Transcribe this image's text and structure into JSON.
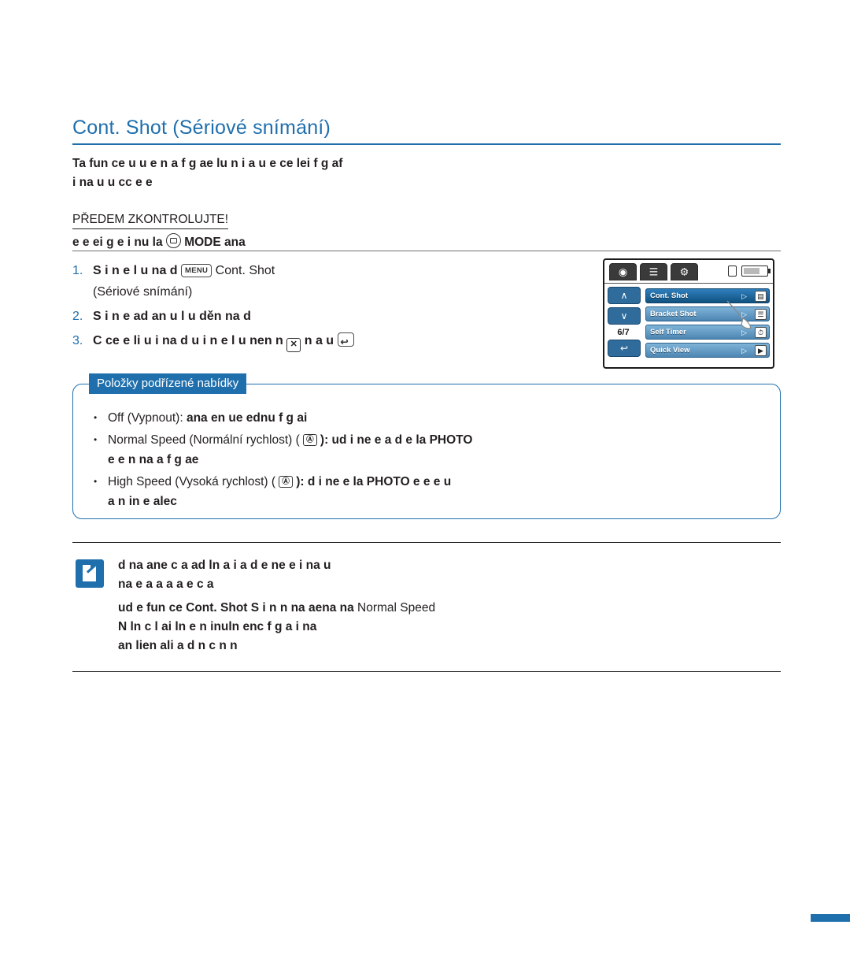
{
  "page": {
    "title": "Cont. Shot (Sériové snímání)",
    "intro_line1": "Ta   fun ce    u   u  e   n a   f     g ae      lu  n     i a        u  e   ce   lei      f     g  af",
    "intro_line2": " i na u     u  cc    e     e    ",
    "precheck_heading": "PŘEDEM ZKONTROLUJTE!",
    "precheck_text_pre": "  e    e   ei     g      e      i   nu     la",
    "precheck_mode_key": "MODE",
    "precheck_text_post": "     ana   "
  },
  "steps": [
    {
      "num": "1.",
      "text_before_key": "S  i   n  e  l   u na  d   ",
      "key": "MENU",
      "text_after_key": "Cont. Shot",
      "subline": "(Sériové snímání)"
    },
    {
      "num": "2.",
      "text": "S  i   n  e    ad  an u    l   u    děn  na  d  "
    },
    {
      "num": "3.",
      "text_a": "C  ce   e  li    u   i   na  d u     i   n  e  l      u   nen  n",
      "text_b": " n a  u "
    }
  ],
  "lcd": {
    "page_indicator": "6/7",
    "tabs": [
      "camera-tab",
      "menu-tab",
      "settings-tab"
    ],
    "menu_items": [
      {
        "label": "Cont. Shot",
        "selected": true,
        "arrow": "▷",
        "right_icon": "▤"
      },
      {
        "label": "Bracket Shot",
        "selected": false,
        "arrow": "▷",
        "right_icon": "☰"
      },
      {
        "label": "Self Timer",
        "selected": false,
        "arrow": "▷",
        "right_icon": "⏱"
      },
      {
        "label": "Quick View",
        "selected": false,
        "arrow": "▷",
        "right_icon": "▶"
      }
    ],
    "nav_up": "∧",
    "nav_down": "∨",
    "back": "↩"
  },
  "submenu": {
    "title": "Položky podřízené nabídky",
    "items": [
      {
        "bullet": "•",
        "label": "Off (Vypnout):",
        "rest": "   ana  en   ue   ednu f     g ai "
      },
      {
        "bullet": "•",
        "label": "Normal Speed (Normální rychlost) (",
        "badge": "Ⓐ",
        "rest": "):      ud    i   ne  e a    d   e   la      PHOTO ",
        "line2": "  e  e     n na    a   f     g ae "
      },
      {
        "bullet": "•",
        "label": "High Speed (Vysoká rychlost) (",
        "badge": "Ⓐ",
        "rest": "):    d    i   ne  e   la      PHOTO    e  e   e    u ",
        "line2": "a     n    in   e  alec   "
      }
    ]
  },
  "note": {
    "items": [
      {
        "line1": "   d na    ane c    a      ad   ln a   i    a  d     e    ne  e   i     na  u ",
        "line2": " na    e a   a  a      a   e  c        a "
      },
      {
        "line1_a": "     ud   e fun  ce ",
        "line1_code": "Cont. Shot",
        "line1_b": "  S  i   n  n  na   aena na ",
        "line1_c": "Normal Speed",
        "line2": " N    ln  c  l        ai ln   e     n inuln   enc  f     g a i  na",
        "line3": "  an     lien    ali  a    d n  c    n n "
      }
    ]
  }
}
